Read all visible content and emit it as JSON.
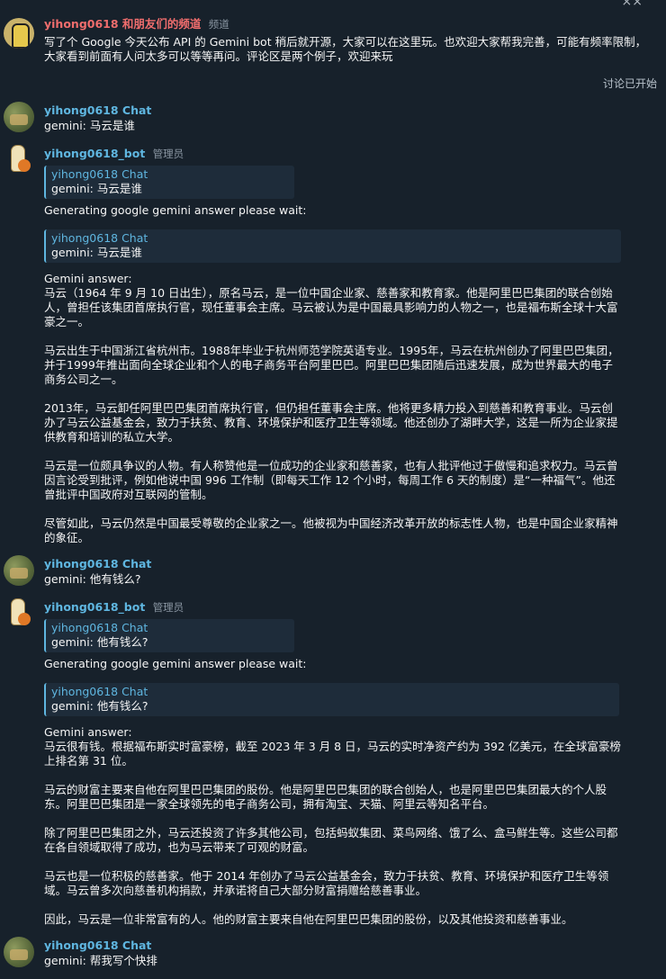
{
  "window": {
    "close_symbol": "⨯⨯"
  },
  "channel_post": {
    "channel_name": "yihong0618 和朋友们的频道",
    "tag": "频道",
    "text": "写了个 Google 今天公布 API 的 Gemini bot 稍后就开源，大家可以在这里玩。也欢迎大家帮我完善，可能有频率限制，大家看到前面有人问太多可以等等再问。评论区是两个例子，欢迎来玩"
  },
  "discussion_label": "讨论已开始",
  "messages": {
    "user1": {
      "name": "yihong0618 Chat",
      "text": "gemini: 马云是谁"
    },
    "bot1": {
      "name": "yihong0618_bot",
      "role": "管理员",
      "quote1": {
        "name": "yihong0618 Chat",
        "text": "gemini: 马云是谁"
      },
      "wait_text": "Generating google gemini answer please wait:",
      "quote2": {
        "name": "yihong0618 Chat",
        "text": "gemini: 马云是谁"
      },
      "answer_label": "Gemini answer:",
      "paragraphs": [
        "马云（1964 年 9 月 10 日出生），原名马云，是一位中国企业家、慈善家和教育家。他是阿里巴巴集团的联合创始人，曾担任该集团首席执行官，现任董事会主席。马云被认为是中国最具影响力的人物之一，也是福布斯全球十大富豪之一。",
        "马云出生于中国浙江省杭州市。1988年毕业于杭州师范学院英语专业。1995年，马云在杭州创办了阿里巴巴集团，并于1999年推出面向全球企业和个人的电子商务平台阿里巴巴。阿里巴巴集团随后迅速发展，成为世界最大的电子商务公司之一。",
        "2013年，马云卸任阿里巴巴集团首席执行官，但仍担任董事会主席。他将更多精力投入到慈善和教育事业。马云创办了马云公益基金会，致力于扶贫、教育、环境保护和医疗卫生等领域。他还创办了湖畔大学，这是一所为企业家提供教育和培训的私立大学。",
        "马云是一位颇具争议的人物。有人称赞他是一位成功的企业家和慈善家，也有人批评他过于傲慢和追求权力。马云曾因言论受到批评，例如他说中国 996 工作制（即每天工作 12 个小时，每周工作 6 天的制度）是“一种福气”。他还曾批评中国政府对互联网的管制。",
        "尽管如此，马云仍然是中国最受尊敬的企业家之一。他被视为中国经济改革开放的标志性人物，也是中国企业家精神的象征。"
      ]
    },
    "user2": {
      "name": "yihong0618 Chat",
      "text": "gemini: 他有钱么?"
    },
    "bot2": {
      "name": "yihong0618_bot",
      "role": "管理员",
      "quote1": {
        "name": "yihong0618 Chat",
        "text": "gemini: 他有钱么?"
      },
      "wait_text": "Generating google gemini answer please wait:",
      "quote2": {
        "name": "yihong0618 Chat",
        "text": "gemini: 他有钱么?"
      },
      "answer_label": "Gemini answer:",
      "paragraphs": [
        "马云很有钱。根据福布斯实时富豪榜，截至 2023 年 3 月 8 日，马云的实时净资产约为 392 亿美元，在全球富豪榜上排名第 31 位。",
        "马云的财富主要来自他在阿里巴巴集团的股份。他是阿里巴巴集团的联合创始人，也是阿里巴巴集团最大的个人股东。阿里巴巴集团是一家全球领先的电子商务公司，拥有淘宝、天猫、阿里云等知名平台。",
        "除了阿里巴巴集团之外，马云还投资了许多其他公司，包括蚂蚁集团、菜鸟网络、饿了么、盒马鲜生等。这些公司都在各自领域取得了成功，也为马云带来了可观的财富。",
        "马云也是一位积极的慈善家。他于 2014 年创办了马云公益基金会，致力于扶贫、教育、环境保护和医疗卫生等领域。马云曾多次向慈善机构捐款，并承诺将自己大部分财富捐赠给慈善事业。",
        "因此，马云是一位非常富有的人。他的财富主要来自他在阿里巴巴集团的股份，以及其他投资和慈善事业。"
      ]
    },
    "user3": {
      "name": "yihong0618 Chat",
      "text": "gemini: 帮我写个快排"
    }
  }
}
